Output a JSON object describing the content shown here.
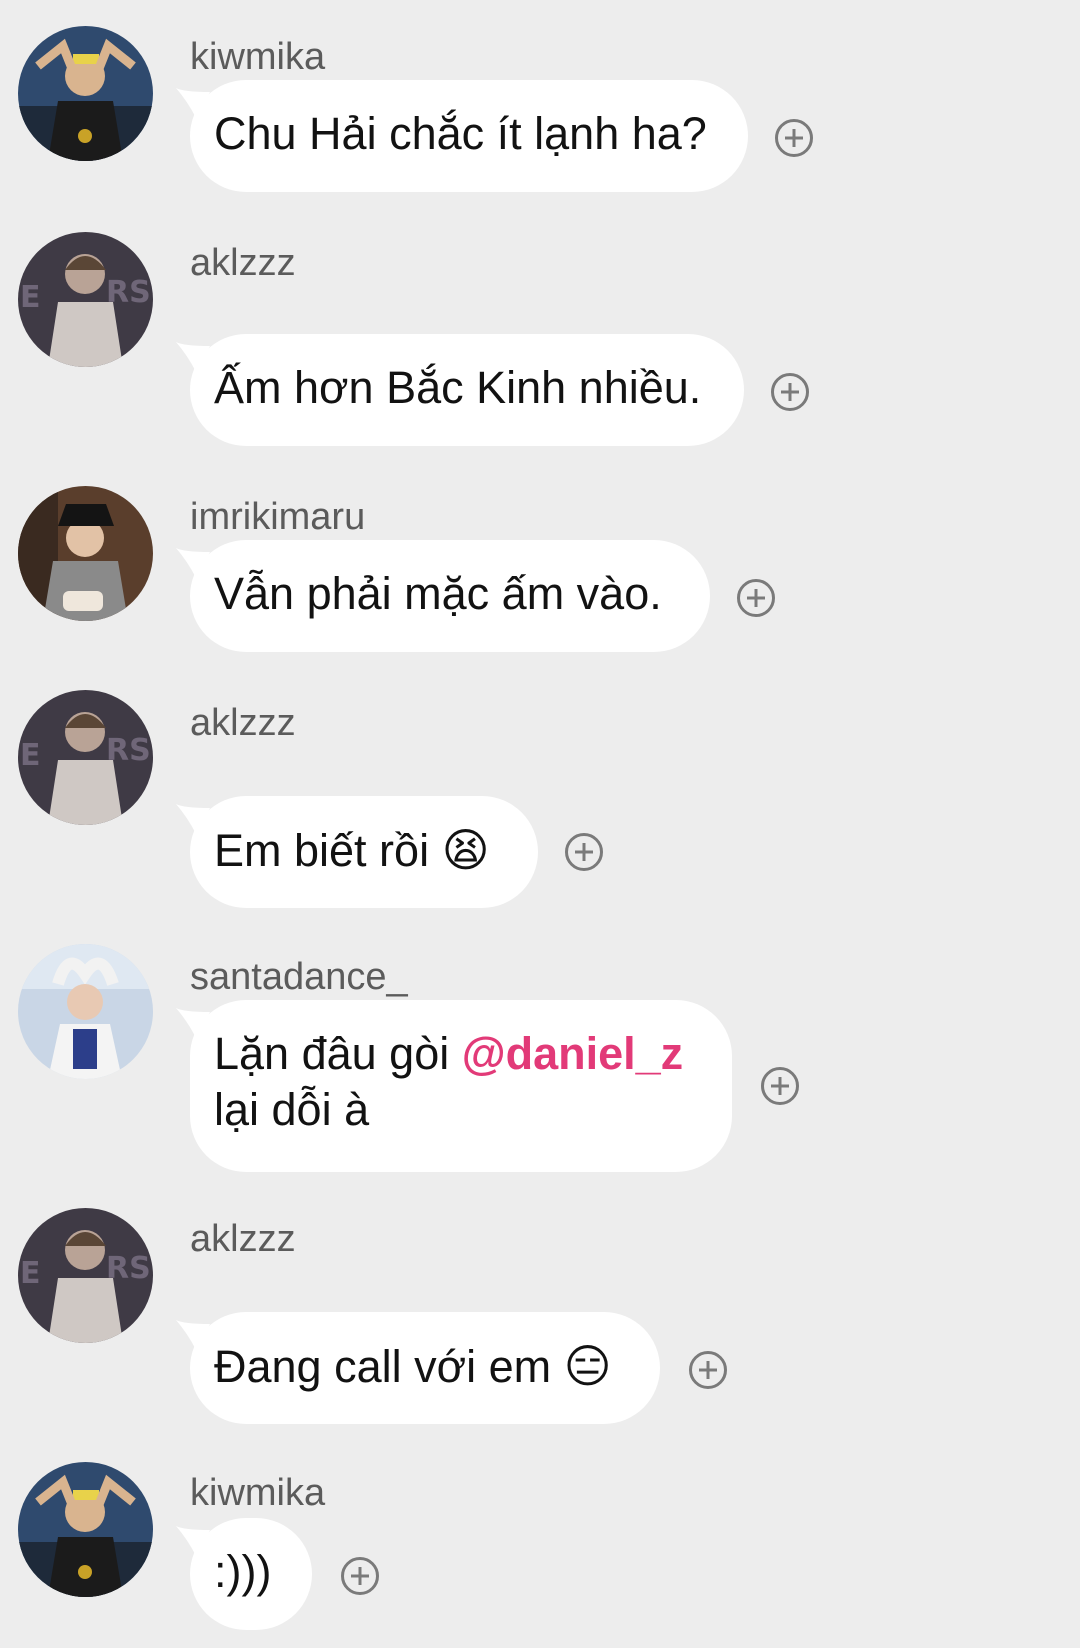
{
  "messages": [
    {
      "user": "kiwmika",
      "text": "Chu Hải chắc ít lạnh ha?"
    },
    {
      "user": "aklzzz",
      "text": "Ấm hơn Bắc Kinh nhiều."
    },
    {
      "user": "imrikimaru",
      "text": "Vẫn phải mặc ấm vào."
    },
    {
      "user": "aklzzz",
      "text": "Em biết rồi",
      "emoji": "😫"
    },
    {
      "user": "santadance_",
      "text_line1": "Lặn đâu gòi ",
      "mention": "@daniel_z",
      "text_line2": "lại dỗi à"
    },
    {
      "user": "aklzzz",
      "text": "Đang call với em",
      "emoji": "😑"
    },
    {
      "user": "kiwmika",
      "text": ":)))"
    }
  ],
  "colors": {
    "background": "#ededed",
    "bubble": "#ffffff",
    "mention": "#e23a78",
    "username": "#5b5b5b"
  }
}
